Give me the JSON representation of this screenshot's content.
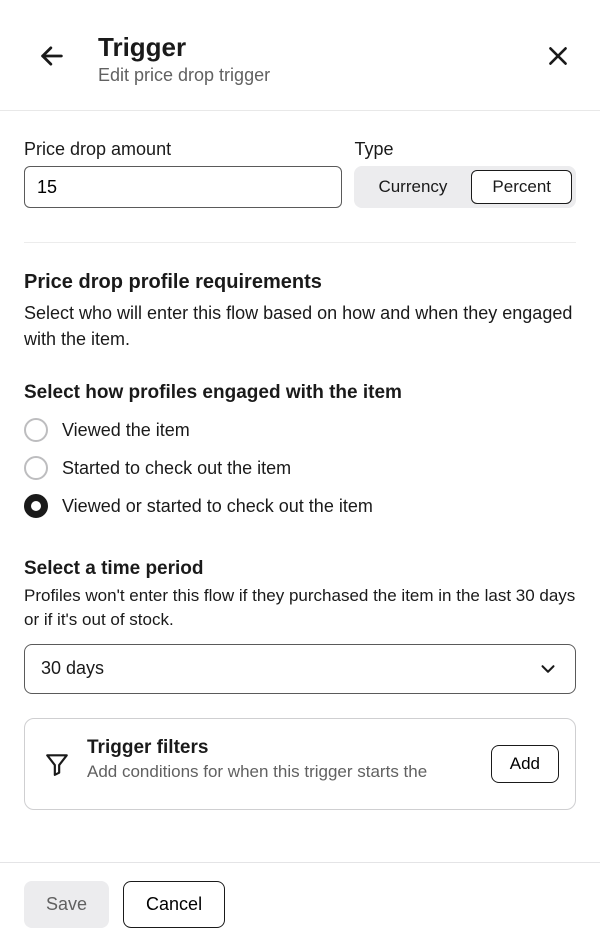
{
  "header": {
    "title": "Trigger",
    "subtitle": "Edit price drop trigger"
  },
  "amount": {
    "label": "Price drop amount",
    "value": "15"
  },
  "type": {
    "label": "Type",
    "options": [
      "Currency",
      "Percent"
    ],
    "selected": "Percent"
  },
  "requirements": {
    "title": "Price drop profile requirements",
    "description": "Select who will enter this flow based on how and when they engaged with the item."
  },
  "engagement": {
    "title": "Select how profiles engaged with the item",
    "options": [
      "Viewed the item",
      "Started to check out the item",
      "Viewed or started to check out the item"
    ],
    "selected": "Viewed or started to check out the item"
  },
  "time_period": {
    "title": "Select a time period",
    "description": "Profiles won't enter this flow if they purchased the item in the last 30 days or if it's out of stock.",
    "value": "30 days"
  },
  "filters": {
    "title": "Trigger filters",
    "description": "Add conditions for when this trigger starts the",
    "add_label": "Add"
  },
  "footer": {
    "save_label": "Save",
    "cancel_label": "Cancel"
  }
}
